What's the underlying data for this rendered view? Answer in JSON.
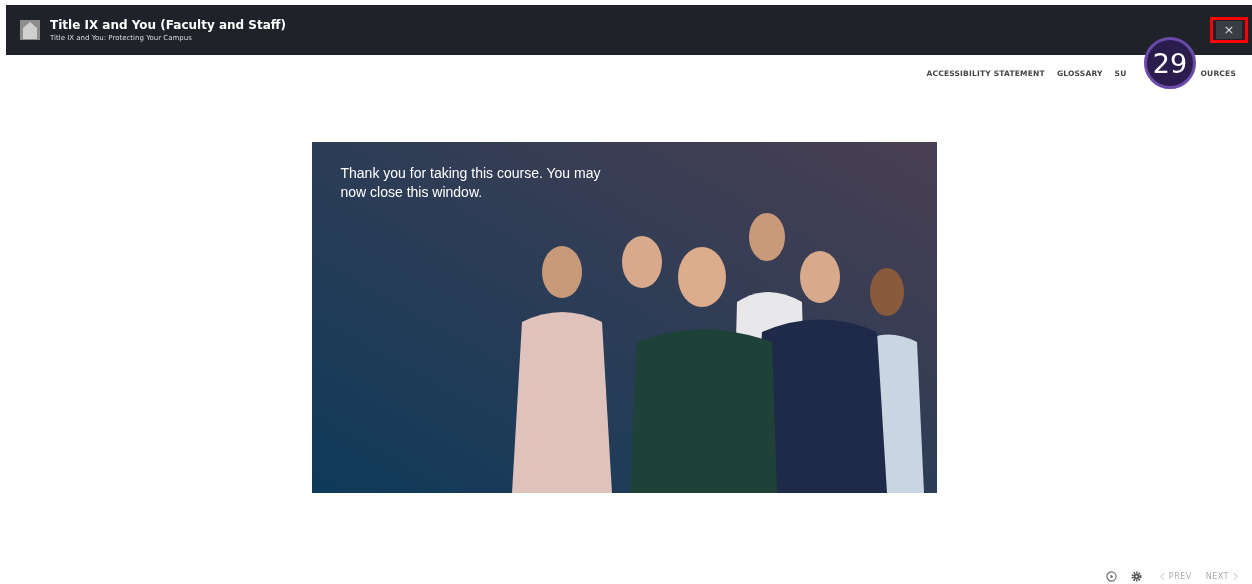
{
  "header": {
    "title": "Title IX and You (Faculty and Staff)",
    "subtitle": "Title IX and You: Protecting Your Campus",
    "close_label": "×"
  },
  "annotation": {
    "label": "29"
  },
  "nav_links": [
    {
      "parts": [
        "ACCESSIBILITY STATEMENT"
      ]
    },
    {
      "parts": [
        "GLOSSARY"
      ]
    },
    {
      "parts": [
        "SU",
        "OURCES"
      ]
    }
  ],
  "slide": {
    "message": "Thank you for taking this course. You may now close this window.",
    "kind": "picture"
  },
  "footer": {
    "prev_label": "PREV",
    "next_label": "NEXT"
  }
}
